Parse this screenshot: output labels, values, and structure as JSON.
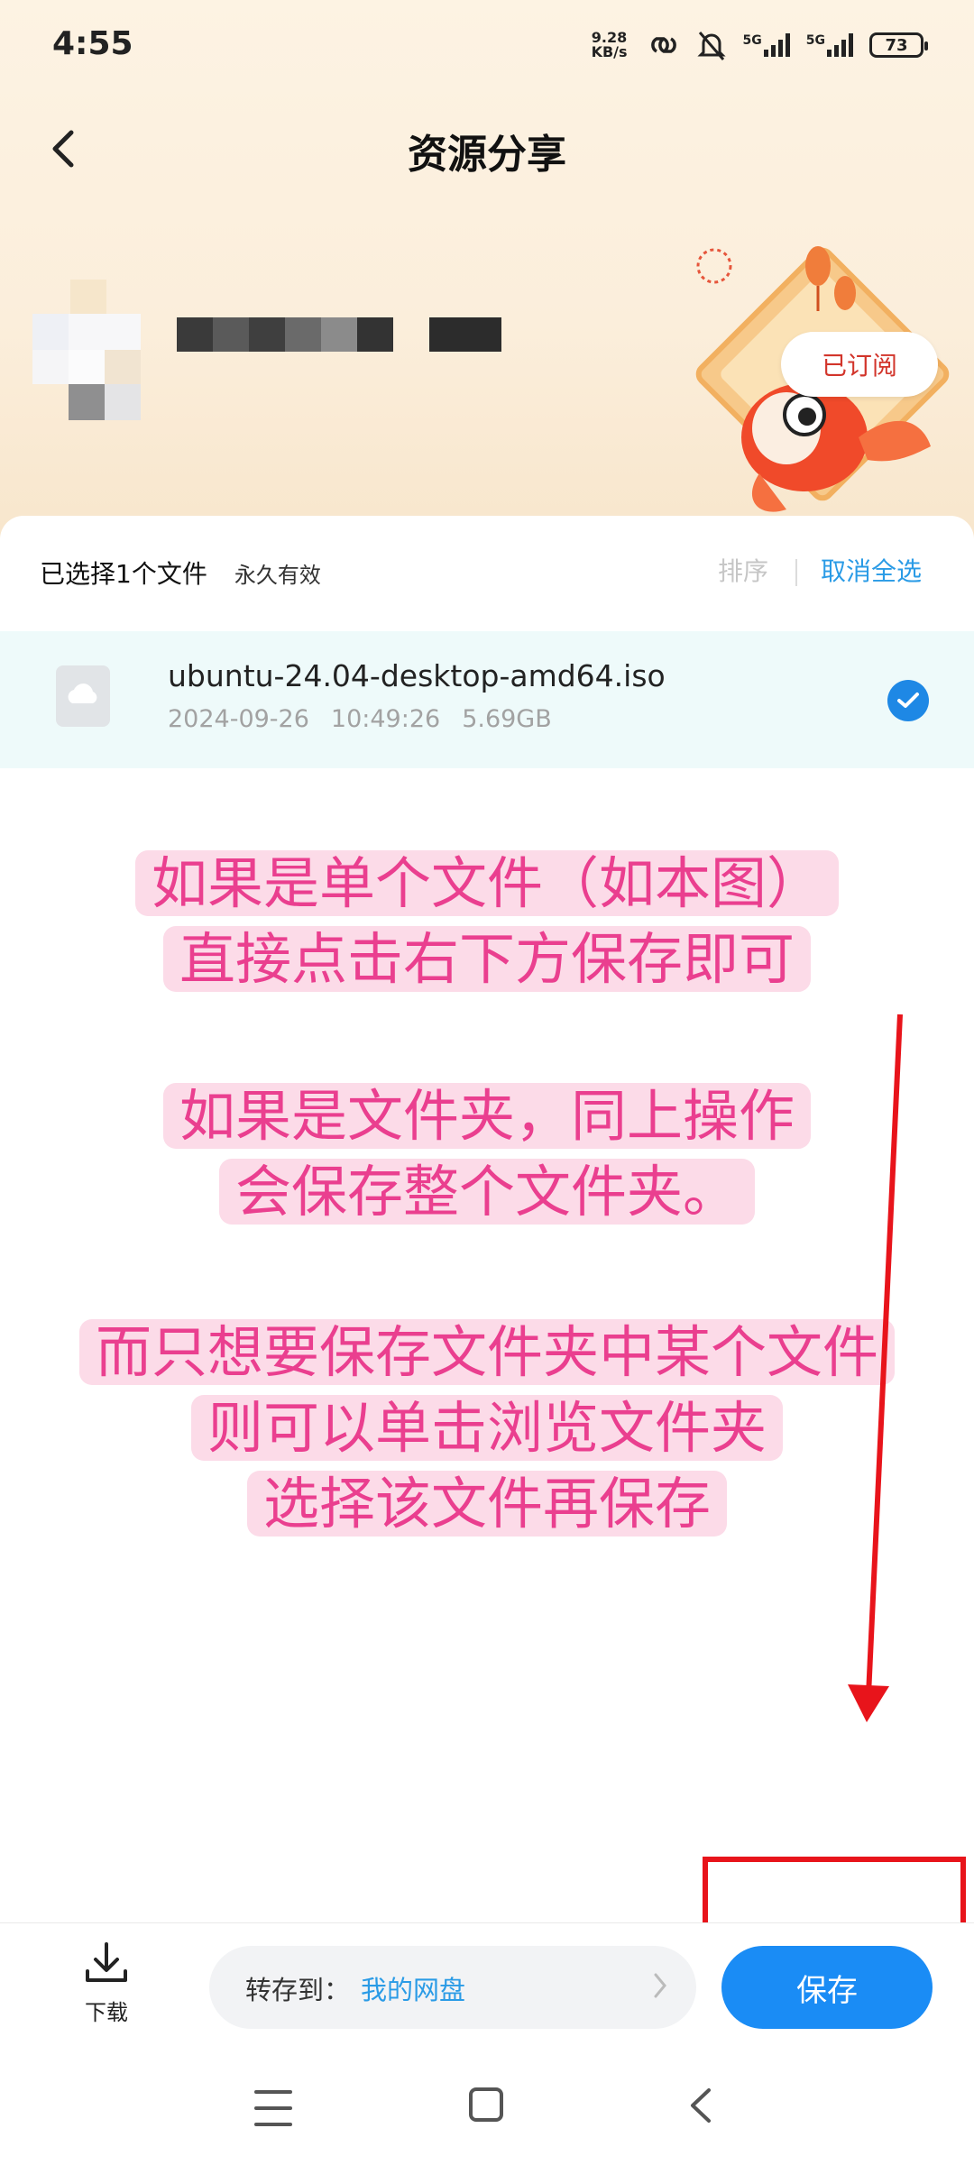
{
  "status_bar": {
    "time": "4:55",
    "net_speed_value": "9.28",
    "net_speed_unit": "KB/s",
    "signal1_label": "5G",
    "signal2_label": "5G",
    "battery": "73"
  },
  "header": {
    "title": "资源分享",
    "back_icon": "chevron-left-icon"
  },
  "sharer": {
    "subscribe_label": "已订阅"
  },
  "selection": {
    "count_text": "已选择1个文件",
    "validity": "永久有效",
    "sort_label": "排序",
    "cancel_all_label": "取消全选"
  },
  "file": {
    "name": "ubuntu-24.04-desktop-amd64.iso",
    "date": "2024-09-26",
    "time": "10:49:26",
    "size": "5.69GB",
    "icon": "cloud-file-icon",
    "selected": true
  },
  "notes": {
    "note1_line1": "如果是单个文件（如本图）",
    "note1_line2": "直接点击右下方保存即可",
    "note2_line1": "如果是文件夹，同上操作",
    "note2_line2": "会保存整个文件夹。",
    "note3_line1": "而只想要保存文件夹中某个文件",
    "note3_line2": "则可以单击浏览文件夹",
    "note3_line3": "选择该文件再保存"
  },
  "bottom": {
    "download_label": "下载",
    "dest_label": "转存到：",
    "dest_value": "我的网盘",
    "save_label": "保存"
  },
  "colors": {
    "accent": "#1a8cf5",
    "link": "#2a9be6",
    "annotation_red": "#e8141b",
    "note_pink": "#ea3f8f"
  }
}
